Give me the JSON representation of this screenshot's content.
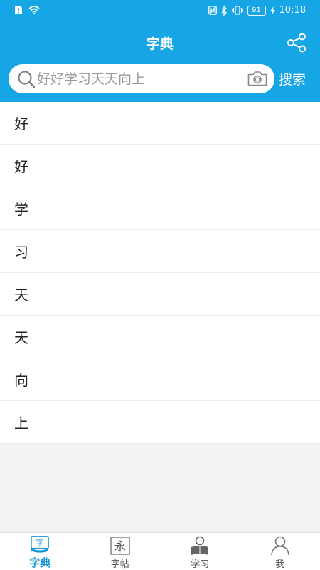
{
  "status_bar": {
    "time": "10:18",
    "battery": "91"
  },
  "header": {
    "title": "字典"
  },
  "search": {
    "placeholder": "好好学习天天向上",
    "button_label": "搜索"
  },
  "results": [
    {
      "char": "好"
    },
    {
      "char": "好"
    },
    {
      "char": "学"
    },
    {
      "char": "习"
    },
    {
      "char": "天"
    },
    {
      "char": "天"
    },
    {
      "char": "向"
    },
    {
      "char": "上"
    }
  ],
  "tabs": [
    {
      "label": "字典",
      "icon": "dictionary-icon",
      "active": true
    },
    {
      "label": "字帖",
      "icon": "copybook-icon",
      "active": false
    },
    {
      "label": "学习",
      "icon": "study-icon",
      "active": false
    },
    {
      "label": "我",
      "icon": "profile-icon",
      "active": false
    }
  ],
  "colors": {
    "accent": "#16a6e6",
    "tab_active": "#1496d8"
  }
}
